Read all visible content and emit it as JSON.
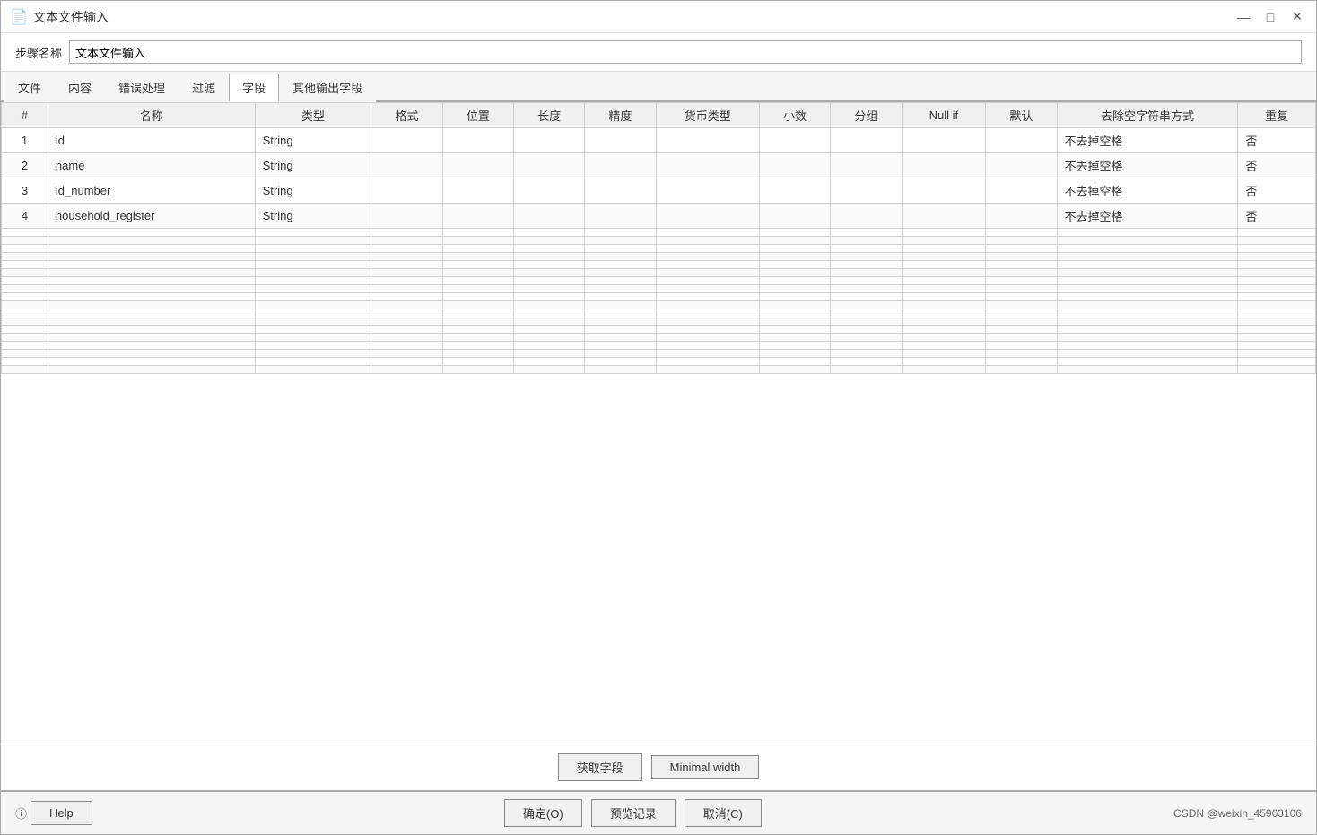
{
  "window": {
    "title": "文本文件输入",
    "icon": "📄",
    "controls": {
      "minimize": "—",
      "maximize": "□",
      "close": "✕"
    }
  },
  "step_name": {
    "label": "步骤名称",
    "value": "文本文件输入"
  },
  "tabs": [
    {
      "id": "file",
      "label": "文件"
    },
    {
      "id": "content",
      "label": "内容"
    },
    {
      "id": "error",
      "label": "错误处理"
    },
    {
      "id": "filter",
      "label": "过滤"
    },
    {
      "id": "fields",
      "label": "字段",
      "active": true
    },
    {
      "id": "other",
      "label": "其他输出字段"
    }
  ],
  "table": {
    "columns": [
      {
        "id": "num",
        "label": "#"
      },
      {
        "id": "name",
        "label": "名称"
      },
      {
        "id": "type",
        "label": "类型"
      },
      {
        "id": "format",
        "label": "格式"
      },
      {
        "id": "pos",
        "label": "位置"
      },
      {
        "id": "length",
        "label": "长度"
      },
      {
        "id": "precision",
        "label": "精度"
      },
      {
        "id": "currency",
        "label": "货币类型"
      },
      {
        "id": "decimal",
        "label": "小数"
      },
      {
        "id": "group",
        "label": "分组"
      },
      {
        "id": "nullif",
        "label": "Null if"
      },
      {
        "id": "default",
        "label": "默认"
      },
      {
        "id": "trim",
        "label": "去除空字符串方式"
      },
      {
        "id": "repeat",
        "label": "重复"
      }
    ],
    "rows": [
      {
        "num": "1",
        "name": "id",
        "type": "String",
        "format": "",
        "pos": "",
        "length": "",
        "precision": "",
        "currency": "",
        "decimal": "",
        "group": "",
        "nullif": "",
        "default": "",
        "trim": "不去掉空格",
        "repeat": "否"
      },
      {
        "num": "2",
        "name": "name",
        "type": "String",
        "format": "",
        "pos": "",
        "length": "",
        "precision": "",
        "currency": "",
        "decimal": "",
        "group": "",
        "nullif": "",
        "default": "",
        "trim": "不去掉空格",
        "repeat": "否"
      },
      {
        "num": "3",
        "name": "id_number",
        "type": "String",
        "format": "",
        "pos": "",
        "length": "",
        "precision": "",
        "currency": "",
        "decimal": "",
        "group": "",
        "nullif": "",
        "default": "",
        "trim": "不去掉空格",
        "repeat": "否"
      },
      {
        "num": "4",
        "name": "household_register",
        "type": "String",
        "format": "",
        "pos": "",
        "length": "",
        "precision": "",
        "currency": "",
        "decimal": "",
        "group": "",
        "nullif": "",
        "default": "",
        "trim": "不去掉空格",
        "repeat": "否"
      }
    ]
  },
  "buttons": {
    "get_fields": "获取字段",
    "minimal_width": "Minimal width"
  },
  "footer": {
    "help": "Help",
    "confirm": "确定(O)",
    "preview": "预览记录",
    "cancel": "取消(C)",
    "watermark": "CSDN @weixin_45963106"
  }
}
